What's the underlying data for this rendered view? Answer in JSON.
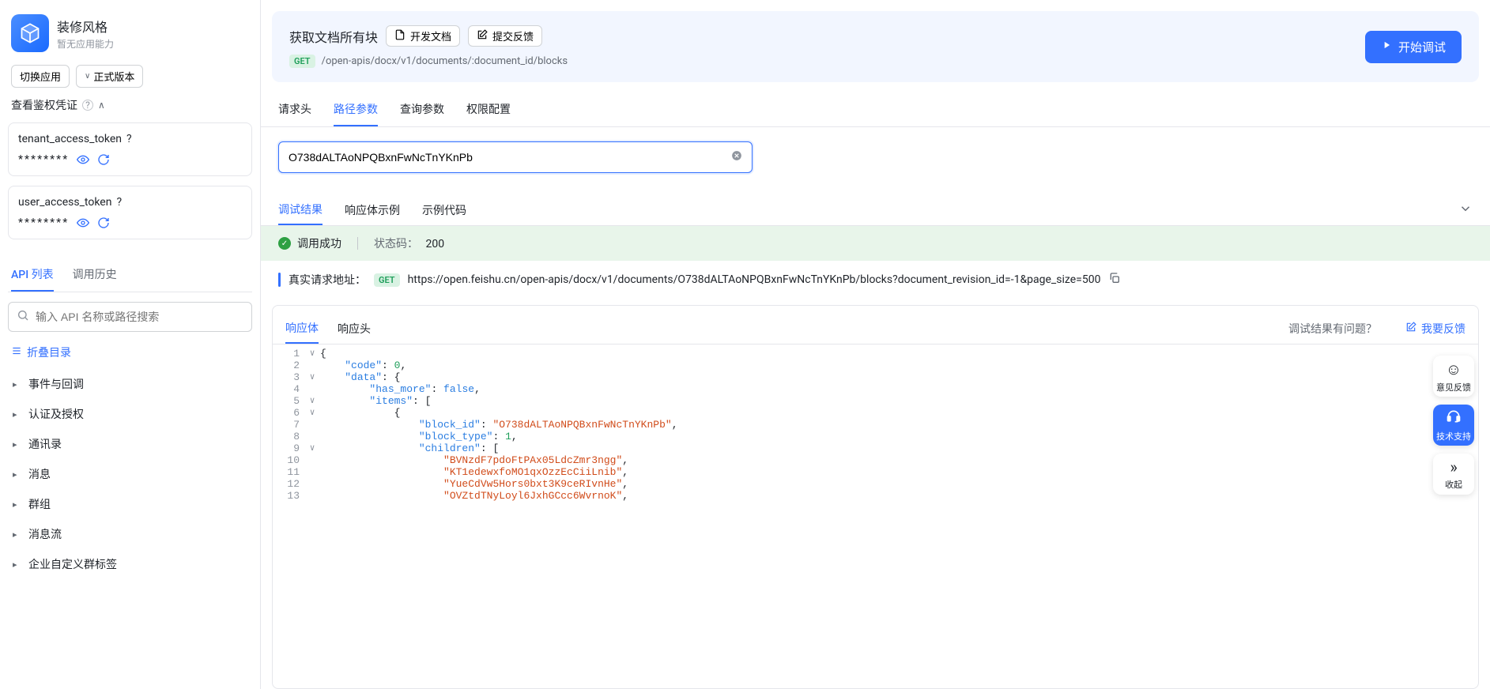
{
  "sidebar": {
    "app_title": "装修风格",
    "app_subtitle": "暂无应用能力",
    "switch_app": "切换应用",
    "version_label": "正式版本",
    "auth_section_title": "查看鉴权凭证",
    "tokens": [
      {
        "name": "tenant_access_token",
        "masked": "********"
      },
      {
        "name": "user_access_token",
        "masked": "********"
      }
    ],
    "tabs": {
      "api_list": "API 列表",
      "history": "调用历史"
    },
    "search_placeholder": "输入 API 名称或路径搜索",
    "collapse_all": "折叠目录",
    "categories": [
      "事件与回调",
      "认证及授权",
      "通讯录",
      "消息",
      "群组",
      "消息流",
      "企业自定义群标签"
    ]
  },
  "api": {
    "title": "获取文档所有块",
    "dev_docs": "开发文档",
    "feedback": "提交反馈",
    "method": "GET",
    "path": "/open-apis/docx/v1/documents/:document_id/blocks",
    "start_debug": "开始调试"
  },
  "param_tabs": {
    "headers": "请求头",
    "path_params": "路径参数",
    "query_params": "查询参数",
    "perm": "权限配置"
  },
  "path_param_value": "O738dALTAoNPQBxnFwNcTnYKnPb",
  "result_tabs": {
    "result": "调试结果",
    "example": "响应体示例",
    "sample_code": "示例代码"
  },
  "status": {
    "success": "调用成功",
    "code_label": "状态码：",
    "code": "200"
  },
  "real_url": {
    "label": "真实请求地址：",
    "method": "GET",
    "url": "https://open.feishu.cn/open-apis/docx/v1/documents/O738dALTAoNPQBxnFwNcTnYKnPb/blocks?document_revision_id=-1&page_size=500"
  },
  "response_tabs": {
    "body": "响应体",
    "resp_headers": "响应头",
    "problem_q": "调试结果有问题？",
    "feedback_link": "我要反馈"
  },
  "code_lines": [
    {
      "n": 1,
      "fold": "∨",
      "tokens": [
        [
          "punc",
          "{"
        ]
      ]
    },
    {
      "n": 2,
      "fold": "",
      "tokens": [
        [
          "indent",
          "    "
        ],
        [
          "key",
          "\"code\""
        ],
        [
          "punc",
          ": "
        ],
        [
          "num",
          "0"
        ],
        [
          "punc",
          ","
        ]
      ]
    },
    {
      "n": 3,
      "fold": "∨",
      "tokens": [
        [
          "indent",
          "    "
        ],
        [
          "key",
          "\"data\""
        ],
        [
          "punc",
          ": {"
        ]
      ]
    },
    {
      "n": 4,
      "fold": "",
      "tokens": [
        [
          "indent",
          "        "
        ],
        [
          "key",
          "\"has_more\""
        ],
        [
          "punc",
          ": "
        ],
        [
          "bool",
          "false"
        ],
        [
          "punc",
          ","
        ]
      ]
    },
    {
      "n": 5,
      "fold": "∨",
      "tokens": [
        [
          "indent",
          "        "
        ],
        [
          "key",
          "\"items\""
        ],
        [
          "punc",
          ": ["
        ]
      ]
    },
    {
      "n": 6,
      "fold": "∨",
      "tokens": [
        [
          "indent",
          "            "
        ],
        [
          "punc",
          "{"
        ]
      ]
    },
    {
      "n": 7,
      "fold": "",
      "tokens": [
        [
          "indent",
          "                "
        ],
        [
          "key",
          "\"block_id\""
        ],
        [
          "punc",
          ": "
        ],
        [
          "str",
          "\"O738dALTAoNPQBxnFwNcTnYKnPb\""
        ],
        [
          "punc",
          ","
        ]
      ]
    },
    {
      "n": 8,
      "fold": "",
      "tokens": [
        [
          "indent",
          "                "
        ],
        [
          "key",
          "\"block_type\""
        ],
        [
          "punc",
          ": "
        ],
        [
          "num",
          "1"
        ],
        [
          "punc",
          ","
        ]
      ]
    },
    {
      "n": 9,
      "fold": "∨",
      "tokens": [
        [
          "indent",
          "                "
        ],
        [
          "key",
          "\"children\""
        ],
        [
          "punc",
          ": ["
        ]
      ]
    },
    {
      "n": 10,
      "fold": "",
      "tokens": [
        [
          "indent",
          "                    "
        ],
        [
          "str",
          "\"BVNzdF7pdoFtPAx05LdcZmr3ngg\""
        ],
        [
          "punc",
          ","
        ]
      ]
    },
    {
      "n": 11,
      "fold": "",
      "tokens": [
        [
          "indent",
          "                    "
        ],
        [
          "str",
          "\"KT1edewxfoMO1qxOzzEcCiiLnib\""
        ],
        [
          "punc",
          ","
        ]
      ]
    },
    {
      "n": 12,
      "fold": "",
      "tokens": [
        [
          "indent",
          "                    "
        ],
        [
          "str",
          "\"YueCdVw5Hors0bxt3K9ceRIvnHe\""
        ],
        [
          "punc",
          ","
        ]
      ]
    },
    {
      "n": 13,
      "fold": "",
      "tokens": [
        [
          "indent",
          "                    "
        ],
        [
          "str",
          "\"OVZtdTNyLoyl6JxhGCcc6WvrnoK\""
        ],
        [
          "punc",
          ","
        ]
      ]
    }
  ],
  "float": {
    "feedback": "意见反馈",
    "support": "技术支持",
    "collapse": "收起"
  }
}
